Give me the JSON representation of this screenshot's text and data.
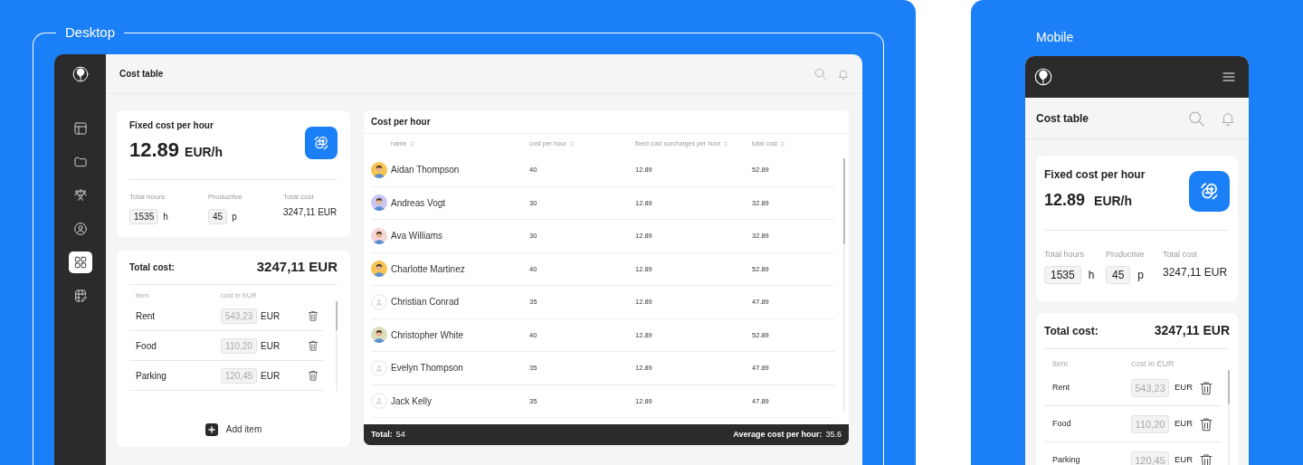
{
  "labels": {
    "desktop": "Desktop",
    "mobile": "Mobile"
  },
  "desktop": {
    "sidebar": [
      {
        "kind": "layout",
        "selected": false
      },
      {
        "kind": "folder",
        "selected": false
      },
      {
        "kind": "people",
        "selected": false
      },
      {
        "kind": "user",
        "selected": false
      },
      {
        "kind": "grid",
        "selected": true
      },
      {
        "kind": "grid-pencil",
        "selected": false
      }
    ],
    "header": {
      "title": "Cost table"
    },
    "fixed_cost": {
      "title": "Fixed cost per hour",
      "value": "12.89",
      "unit": "EUR/h",
      "stats": [
        {
          "kind": "field",
          "label": "Total hours",
          "value": "1535",
          "unit": "h"
        },
        {
          "kind": "field",
          "label": "Productive",
          "value": "45",
          "unit": "p"
        },
        {
          "kind": "text",
          "label": "Total cost",
          "value": "3247,11 EUR"
        }
      ]
    },
    "total_cost": {
      "label": "Total cost:",
      "value": "3247,11 EUR",
      "columns": [
        "item",
        "cost in EUR"
      ],
      "items": [
        {
          "name": "Rent",
          "cost": "543,23",
          "currency": "EUR"
        },
        {
          "name": "Food",
          "cost": "110,20",
          "currency": "EUR"
        },
        {
          "name": "Parking",
          "cost": "120,45",
          "currency": "EUR"
        }
      ],
      "add_button": "Add item"
    },
    "cost_table": {
      "title": "Cost per hour",
      "columns": [
        "name",
        "cost per hour",
        "fixed cost surcharges per hour",
        "total cost"
      ],
      "rows": [
        {
          "name": "Aidan Thompson",
          "cost_per_hour": "40",
          "surcharge": "12.89",
          "total": "52.89"
        },
        {
          "name": "Andreas Vogt",
          "cost_per_hour": "30",
          "surcharge": "12.89",
          "total": "32.89"
        },
        {
          "name": "Ava Williams",
          "cost_per_hour": "30",
          "surcharge": "12.89",
          "total": "32.89"
        },
        {
          "name": "Charlotte Martinez",
          "cost_per_hour": "40",
          "surcharge": "12.89",
          "total": "52.89"
        },
        {
          "name": "Christian Conrad",
          "avatar": {
            "kind": "placeholder"
          },
          "cost_per_hour": "35",
          "surcharge": "12.89",
          "total": "47.89"
        },
        {
          "name": "Christopher White",
          "cost_per_hour": "40",
          "surcharge": "12.89",
          "total": "52.89"
        },
        {
          "name": "Evelyn Thompson",
          "avatar": {
            "kind": "placeholder"
          },
          "cost_per_hour": "35",
          "surcharge": "12.89",
          "total": "47.89"
        },
        {
          "name": "Jack Kelly",
          "avatar": {
            "kind": "placeholder"
          },
          "cost_per_hour": "35",
          "surcharge": "12.89",
          "total": "47.89"
        }
      ],
      "footer": {
        "total_label": "Total:",
        "total": "54",
        "average_label": "Average cost per hour:",
        "average": "35.6"
      }
    }
  },
  "mobile": {
    "header": {
      "title": "Cost table"
    },
    "fixed_cost": {
      "title": "Fixed cost per hour",
      "value": "12.89",
      "unit": "EUR/h",
      "stats": [
        {
          "kind": "field",
          "label": "Total hours",
          "value": "1535",
          "unit": "h"
        },
        {
          "kind": "field",
          "label": "Productive",
          "value": "45",
          "unit": "p"
        },
        {
          "kind": "text",
          "label": "Total cost",
          "value": "3247,11 EUR"
        }
      ]
    },
    "total_cost": {
      "label": "Total cost:",
      "value": "3247,11 EUR",
      "columns": [
        "item",
        "cost in EUR"
      ],
      "items": [
        {
          "name": "Rent",
          "cost": "543,23",
          "currency": "EUR"
        },
        {
          "name": "Food",
          "cost": "110,20",
          "currency": "EUR"
        },
        {
          "name": "Parking",
          "cost": "120,45",
          "currency": "EUR"
        }
      ]
    }
  }
}
